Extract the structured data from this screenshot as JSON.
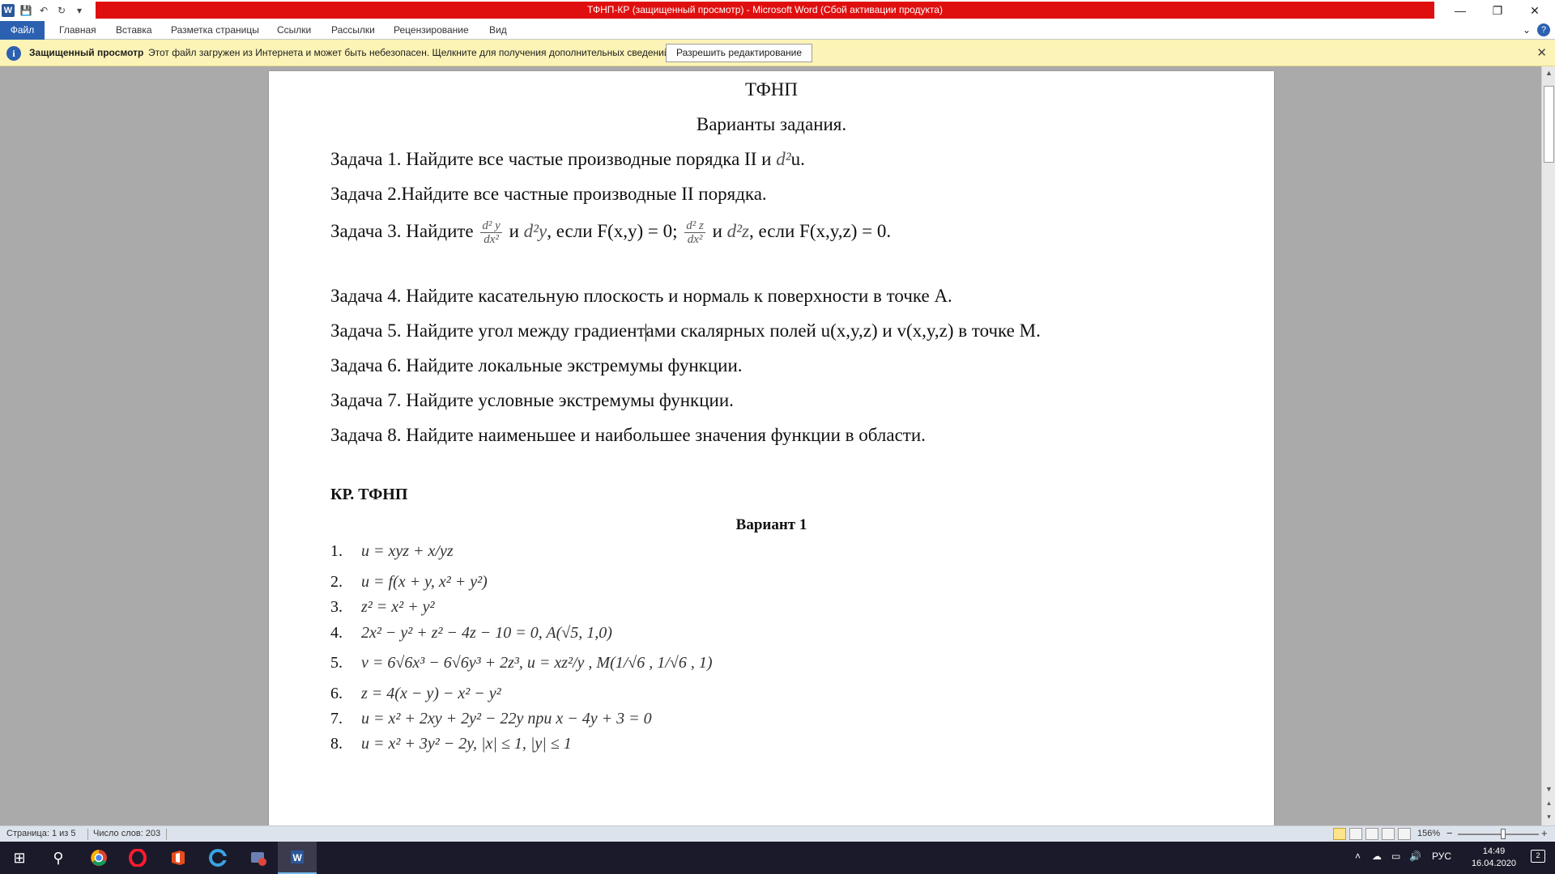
{
  "window": {
    "title": "ТФНП-КР (защищенный просмотр) - Microsoft Word (Сбой активации продукта)",
    "minimize": "—",
    "restore": "❐",
    "close": "✕"
  },
  "qat": {
    "word_logo": "W",
    "save": "💾",
    "undo": "↶",
    "redo": "↻",
    "customize": "▾"
  },
  "ribbon": {
    "tabs": [
      "Файл",
      "Главная",
      "Вставка",
      "Разметка страницы",
      "Ссылки",
      "Рассылки",
      "Рецензирование",
      "Вид"
    ],
    "expand": "⌄",
    "help": "?"
  },
  "protected_view": {
    "info": "i",
    "title": "Защищенный просмотр",
    "message": "Этот файл загружен из Интернета и может быть небезопасен. Щелкните для получения дополнительных сведений.",
    "button": "Разрешить редактирование",
    "close": "✕"
  },
  "document": {
    "heading": "ТФНП",
    "subheading": "Варианты задания.",
    "tasks": {
      "t1_text": "Задача 1. Найдите все частые производные порядка II и ",
      "t1_math": "d²",
      "t1_tail": "u.",
      "t2": "Задача 2.Найдите все частные производные II порядка.",
      "t3_a": "Задача 3. Найдите ",
      "t3_f1_num": "d² y",
      "t3_f1_den": "dx²",
      "t3_b": " и ",
      "t3_m1": "d²y",
      "t3_c": ", если F(x,y) = 0; ",
      "t3_f2_num": "d² z",
      "t3_f2_den": "dx²",
      "t3_d": " и ",
      "t3_m2": "d²z",
      "t3_e": ", если F(x,y,z) = 0.",
      "t4": "Задача 4. Найдите касательную плоскость и нормаль к поверхности в точке А.",
      "t5_a": "Задача 5. Найдите угол между градиент",
      "t5_b": "ами скалярных полей u(x,y,z) и v(x,y,z) в точке М.",
      "t6": "Задача 6. Найдите локальные экстремумы функции.",
      "t7": "Задача 7. Найдите условные экстремумы функции.",
      "t8": "Задача 8. Найдите наименьшее и наибольшее значения функции в области."
    },
    "section_title": "КР. ТФНП",
    "variant_title": "Вариант 1",
    "variant_items": [
      {
        "num": "1.",
        "formula": "u = xyz + x/yz"
      },
      {
        "num": "2.",
        "formula": "u = f(x + y, x² + y²)"
      },
      {
        "num": "3.",
        "formula": "z² = x² + y²"
      },
      {
        "num": "4.",
        "formula": "2x² − y² + z² − 4z − 10 = 0, A(√5, 1,0)"
      },
      {
        "num": "5.",
        "formula": "v = 6√6x³ − 6√6y³ + 2z³, u = xz²/y , M(1/√6 , 1/√6 , 1)"
      },
      {
        "num": "6.",
        "formula": "z = 4(x − y) − x² − y²"
      },
      {
        "num": "7.",
        "formula": "u = x² + 2xy + 2y² − 22y при x − 4y + 3 = 0"
      },
      {
        "num": "8.",
        "formula": "u = x² + 3y² − 2y, |x| ≤ 1, |y| ≤ 1"
      }
    ]
  },
  "statusbar": {
    "page": "Страница: 1 из 5",
    "words": "Число слов: 203",
    "zoom": "156%",
    "zoom_minus": "−",
    "zoom_plus": "+"
  },
  "taskbar": {
    "start": "⊞",
    "search": "⚲",
    "tray_chevron": "˄",
    "cloud": "☁",
    "network": "▭",
    "volume": "🔊",
    "language": "РУС",
    "time": "14:49",
    "date": "16.04.2020",
    "notifications": "2"
  }
}
